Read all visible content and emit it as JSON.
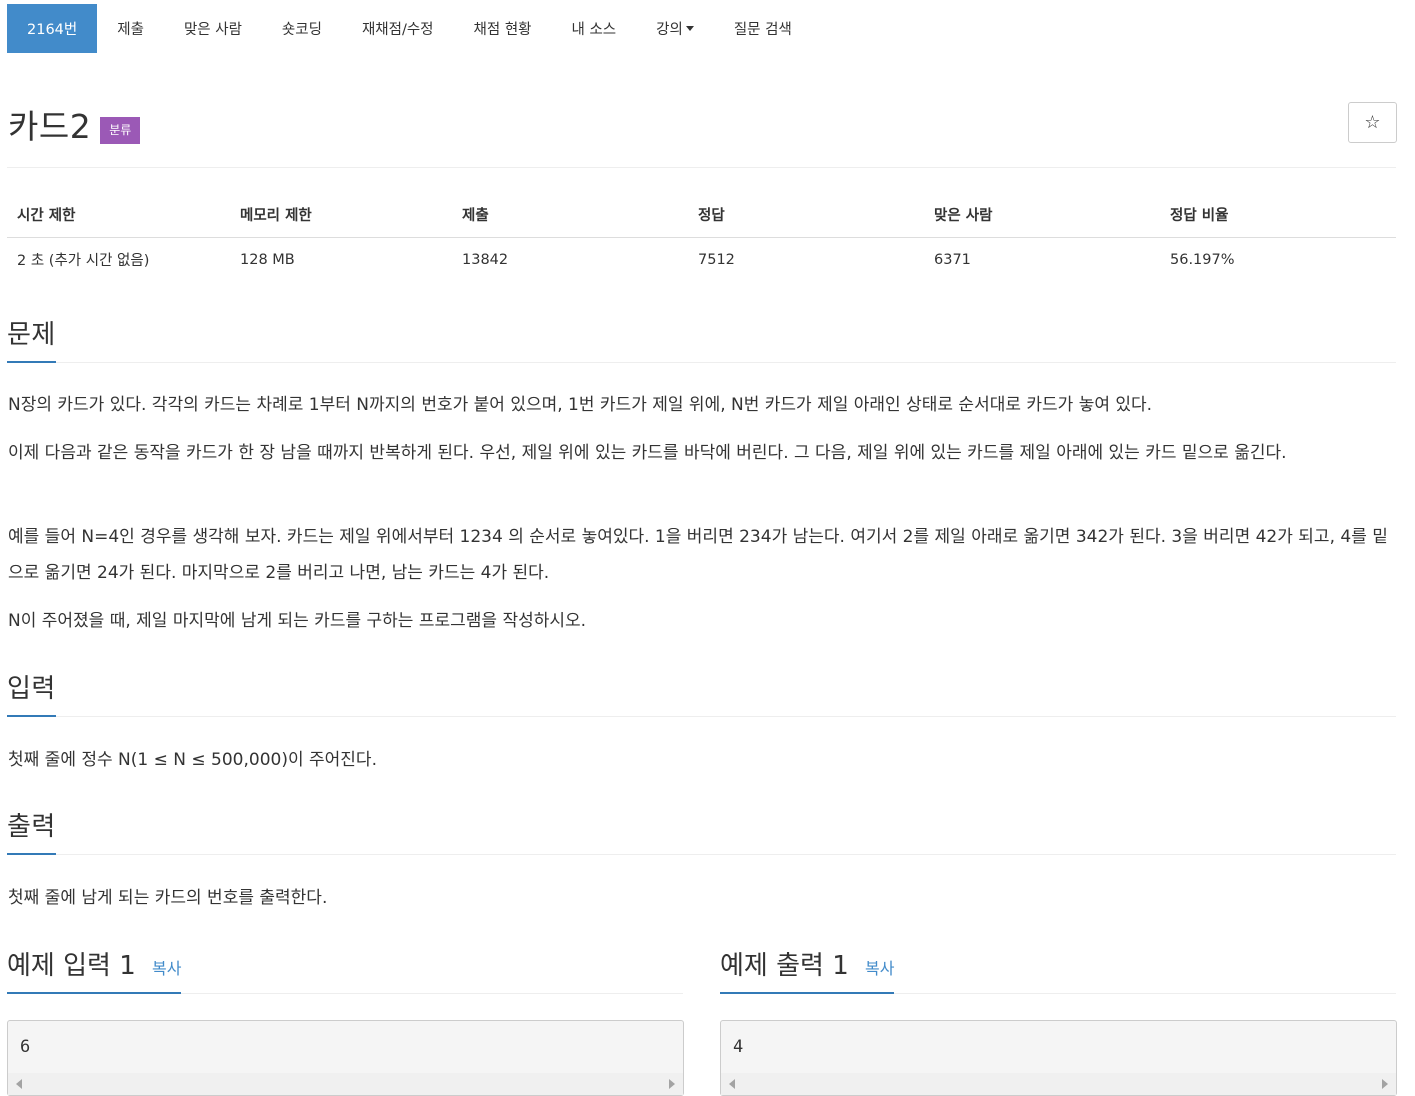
{
  "nav": {
    "tabs": [
      "2164번",
      "제출",
      "맞은 사람",
      "숏코딩",
      "재채점/수정",
      "채점 현황",
      "내 소스",
      "강의",
      "질문 검색"
    ]
  },
  "problem": {
    "title": "카드2",
    "badge": "분류",
    "star_icon": "☆"
  },
  "stats": {
    "headers": [
      "시간 제한",
      "메모리 제한",
      "제출",
      "정답",
      "맞은 사람",
      "정답 비율"
    ],
    "values": [
      "2 초 (추가 시간 없음)",
      "128 MB",
      "13842",
      "7512",
      "6371",
      "56.197%"
    ]
  },
  "sections": {
    "description": {
      "heading": "문제",
      "paragraphs": [
        "N장의 카드가 있다. 각각의 카드는 차례로 1부터 N까지의 번호가 붙어 있으며, 1번 카드가 제일 위에, N번 카드가 제일 아래인 상태로 순서대로 카드가 놓여 있다.",
        "이제 다음과 같은 동작을 카드가 한 장 남을 때까지 반복하게 된다. 우선, 제일 위에 있는 카드를 바닥에 버린다. 그 다음, 제일 위에 있는 카드를 제일 아래에 있는 카드 밑으로 옮긴다.",
        "예를 들어 N=4인 경우를 생각해 보자. 카드는 제일 위에서부터 1234 의 순서로 놓여있다. 1을 버리면 234가 남는다. 여기서 2를 제일 아래로 옮기면 342가 된다. 3을 버리면 42가 되고, 4를 밑으로 옮기면 24가 된다. 마지막으로 2를 버리고 나면, 남는 카드는 4가 된다.",
        "N이 주어졌을 때, 제일 마지막에 남게 되는 카드를 구하는 프로그램을 작성하시오."
      ]
    },
    "input": {
      "heading": "입력",
      "text": "첫째 줄에 정수 N(1 ≤ N ≤ 500,000)이 주어진다."
    },
    "output": {
      "heading": "출력",
      "text": "첫째 줄에 남게 되는 카드의 번호를 출력한다."
    }
  },
  "samples": {
    "input": {
      "heading": "예제 입력 1",
      "copy": "복사",
      "value": "6"
    },
    "output": {
      "heading": "예제 출력 1",
      "copy": "복사",
      "value": "4"
    }
  },
  "colors": {
    "active_tab": "#428bca",
    "badge": "#9b59b6",
    "heading_underline": "#337ab7",
    "copy_link": "#428bca"
  }
}
